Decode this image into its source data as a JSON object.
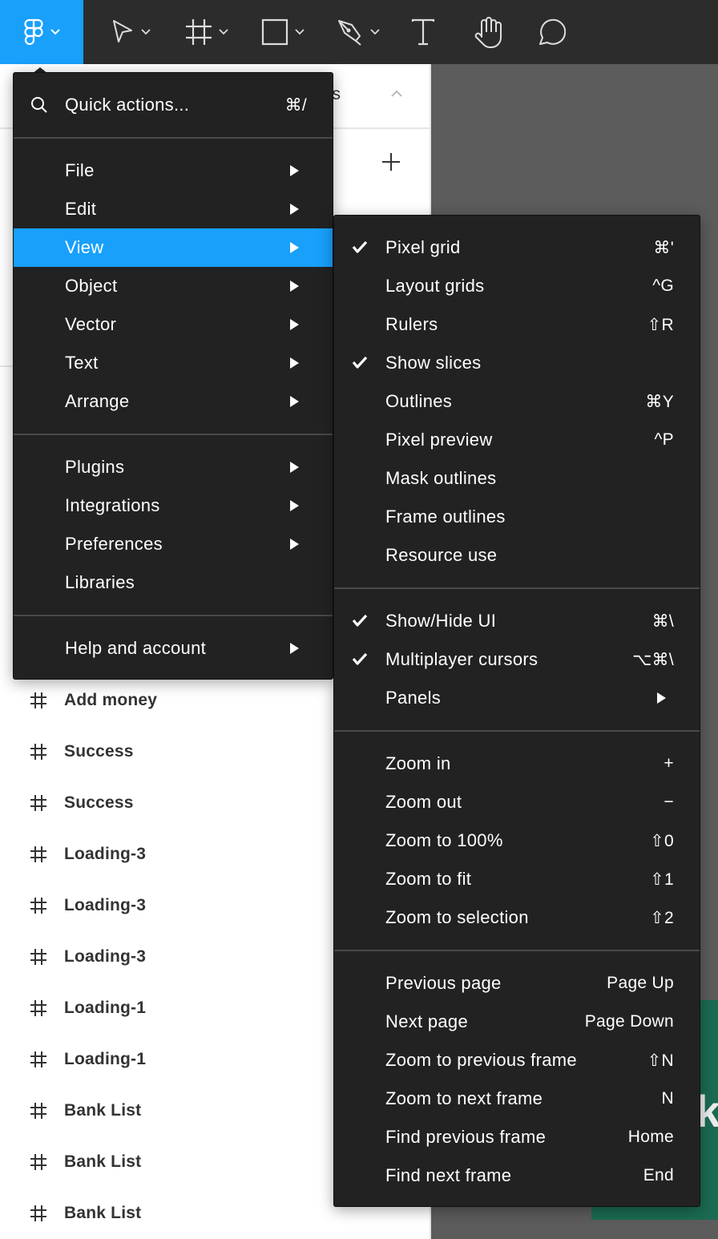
{
  "toolbar": {
    "tools": [
      {
        "name": "main-menu",
        "icon": "figma-logo-icon",
        "has_caret": true,
        "active": true
      },
      {
        "name": "move",
        "icon": "move-cursor-icon",
        "has_caret": true
      },
      {
        "name": "frame",
        "icon": "frame-icon",
        "has_caret": true
      },
      {
        "name": "shape",
        "icon": "rectangle-icon",
        "has_caret": true
      },
      {
        "name": "pen",
        "icon": "pen-icon",
        "has_caret": true
      },
      {
        "name": "text",
        "icon": "text-icon",
        "has_caret": false
      },
      {
        "name": "hand",
        "icon": "hand-icon",
        "has_caret": false
      },
      {
        "name": "comment",
        "icon": "comment-icon",
        "has_caret": false
      }
    ]
  },
  "left_panel": {
    "pages_title": "Screens",
    "pages_title_visible": "creens",
    "add_page_icon": "plus-icon",
    "layers": [
      {
        "name": "Add money",
        "icon": "frame-hash-icon"
      },
      {
        "name": "Success",
        "icon": "frame-hash-icon"
      },
      {
        "name": "Success",
        "icon": "frame-hash-icon"
      },
      {
        "name": "Loading-3",
        "icon": "frame-hash-icon"
      },
      {
        "name": "Loading-3",
        "icon": "frame-hash-icon"
      },
      {
        "name": "Loading-3",
        "icon": "frame-hash-icon"
      },
      {
        "name": "Loading-1",
        "icon": "frame-hash-icon"
      },
      {
        "name": "Loading-1",
        "icon": "frame-hash-icon"
      },
      {
        "name": "Bank List",
        "icon": "frame-hash-icon"
      },
      {
        "name": "Bank List",
        "icon": "frame-hash-icon"
      },
      {
        "name": "Bank List",
        "icon": "frame-hash-icon"
      }
    ]
  },
  "canvas": {
    "frame_text_fragment": "ki",
    "frame_color": "#1b6b52"
  },
  "main_menu": {
    "quick_actions": {
      "label": "Quick actions...",
      "shortcut": "⌘/"
    },
    "groups": [
      [
        {
          "label": "File",
          "submenu": true
        },
        {
          "label": "Edit",
          "submenu": true
        },
        {
          "label": "View",
          "submenu": true,
          "active": true
        },
        {
          "label": "Object",
          "submenu": true
        },
        {
          "label": "Vector",
          "submenu": true
        },
        {
          "label": "Text",
          "submenu": true
        },
        {
          "label": "Arrange",
          "submenu": true
        }
      ],
      [
        {
          "label": "Plugins",
          "submenu": true
        },
        {
          "label": "Integrations",
          "submenu": true
        },
        {
          "label": "Preferences",
          "submenu": true
        },
        {
          "label": "Libraries",
          "submenu": false
        }
      ],
      [
        {
          "label": "Help and account",
          "submenu": true
        }
      ]
    ]
  },
  "view_menu": {
    "groups": [
      [
        {
          "label": "Pixel grid",
          "shortcut": "⌘'",
          "checked": true
        },
        {
          "label": "Layout grids",
          "shortcut": "^G",
          "checked": false
        },
        {
          "label": "Rulers",
          "shortcut": "⇧R",
          "checked": false
        },
        {
          "label": "Show slices",
          "shortcut": "",
          "checked": true
        },
        {
          "label": "Outlines",
          "shortcut": "⌘Y",
          "checked": false
        },
        {
          "label": "Pixel preview",
          "shortcut": "^P",
          "checked": false
        },
        {
          "label": "Mask outlines",
          "shortcut": "",
          "checked": false
        },
        {
          "label": "Frame outlines",
          "shortcut": "",
          "checked": false
        },
        {
          "label": "Resource use",
          "shortcut": "",
          "checked": false
        }
      ],
      [
        {
          "label": "Show/Hide UI",
          "shortcut": "⌘\\",
          "checked": true
        },
        {
          "label": "Multiplayer cursors",
          "shortcut": "⌥⌘\\",
          "checked": true
        },
        {
          "label": "Panels",
          "shortcut": "",
          "checked": false,
          "submenu": true
        }
      ],
      [
        {
          "label": "Zoom in",
          "shortcut": "+"
        },
        {
          "label": "Zoom out",
          "shortcut": "−"
        },
        {
          "label": "Zoom to 100%",
          "shortcut": "⇧0"
        },
        {
          "label": "Zoom to fit",
          "shortcut": "⇧1"
        },
        {
          "label": "Zoom to selection",
          "shortcut": "⇧2"
        }
      ],
      [
        {
          "label": "Previous page",
          "shortcut": "Page Up"
        },
        {
          "label": "Next page",
          "shortcut": "Page Down"
        },
        {
          "label": "Zoom to previous frame",
          "shortcut": "⇧N"
        },
        {
          "label": "Zoom to next frame",
          "shortcut": "N"
        },
        {
          "label": "Find previous frame",
          "shortcut": "Home"
        },
        {
          "label": "Find next frame",
          "shortcut": "End"
        }
      ]
    ]
  },
  "colors": {
    "accent": "#18a0fb",
    "menu_bg": "#222222",
    "toolbar_bg": "#2c2c2c",
    "canvas_bg": "#5c5c5c"
  }
}
